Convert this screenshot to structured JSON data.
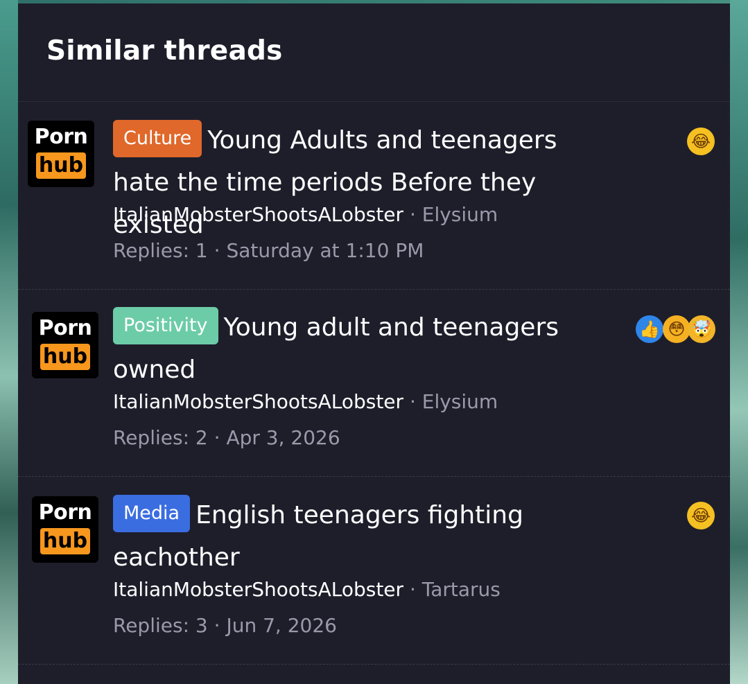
{
  "panel": {
    "title": "Similar threads"
  },
  "threads": [
    {
      "avatar": {
        "line1": "Porn",
        "line2": "hub"
      },
      "tag": "Culture",
      "title": "Young Adults and teenagers hate the time periods Before they existed",
      "author": "ItalianMobsterShootsALobster",
      "forum": "Elysium",
      "replies": "Replies: 1",
      "date": "Saturday at 1:10 PM",
      "reactions": [
        "rofl-icon"
      ]
    },
    {
      "avatar": {
        "line1": "Porn",
        "line2": "hub"
      },
      "tag": "Positivity",
      "title": "Young adult and teenagers owned",
      "author": "ItalianMobsterShootsALobster",
      "forum": "Elysium",
      "replies": "Replies: 2",
      "date": "Apr 3, 2026",
      "reactions": [
        "like-icon",
        "flushed-icon",
        "mind-blown-icon"
      ]
    },
    {
      "avatar": {
        "line1": "Porn",
        "line2": "hub"
      },
      "tag": "Media",
      "title": "English teenagers fighting eachother",
      "author": "ItalianMobsterShootsALobster",
      "forum": "Tartarus",
      "replies": "Replies: 3",
      "date": "Jun 7, 2026",
      "reactions": [
        "rofl-icon"
      ]
    }
  ],
  "separator": "·",
  "colors": {
    "panel_bg": "#1e1e2b",
    "culture": "#e0682a",
    "positivity": "#6ccca8",
    "media": "#3a6de0",
    "muted": "#9a9aab"
  }
}
